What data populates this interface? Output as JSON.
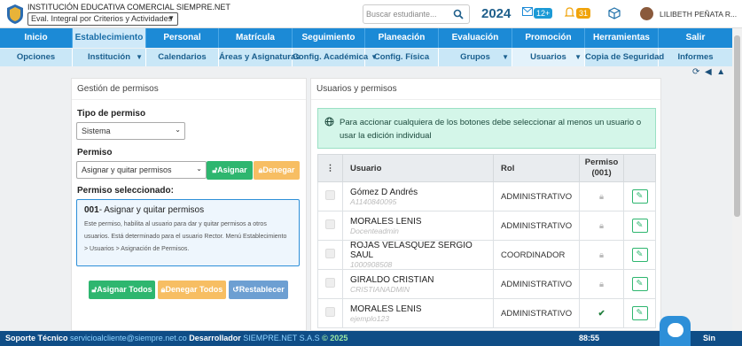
{
  "header": {
    "institution": "INSTITUCIÓN EDUCATIVA COMERCIAL SIEMPRE.NET",
    "evaluation_select": "Eval. Integral por Criterios y Actividades",
    "search_placeholder": "Buscar estudiante...",
    "year": "2024",
    "messages_badge": "12+",
    "notifications_badge": "31",
    "user_name": "LILIBETH PEÑATA R..."
  },
  "main_nav": [
    "Inicio",
    "Establecimiento",
    "Personal",
    "Matrícula",
    "Seguimiento",
    "Planeación",
    "Evaluación",
    "Promoción",
    "Herramientas",
    "Salir"
  ],
  "sub_nav": [
    {
      "label": "Opciones",
      "arrow": false
    },
    {
      "label": "Institución",
      "arrow": true
    },
    {
      "label": "Calendarios",
      "arrow": false
    },
    {
      "label": "Áreas y Asignaturas",
      "arrow": false
    },
    {
      "label": "Config. Académica",
      "arrow": true
    },
    {
      "label": "Config. Física",
      "arrow": false
    },
    {
      "label": "Grupos",
      "arrow": true
    },
    {
      "label": "Usuarios",
      "arrow": true
    },
    {
      "label": "Copia de Seguridad",
      "arrow": false
    },
    {
      "label": "Informes",
      "arrow": false
    }
  ],
  "left_panel": {
    "title": "Gestión de permisos",
    "tipo_label": "Tipo de permiso",
    "tipo_value": "Sistema",
    "permiso_label": "Permiso",
    "permiso_value": "Asignar y quitar permisos",
    "asignar_btn": "Asignar",
    "denegar_btn": "Denegar",
    "selected_label": "Permiso seleccionado:",
    "selected_code": "001",
    "selected_name": "- Asignar y quitar permisos",
    "selected_desc": "Este permiso, habilita al usuario para dar y quitar permisos a otros usuarios. Está determinado para el usuario Rector. Menú Establecimiento > Usuarios > Asignación de Permisos.",
    "asignar_todos_btn": "Asignar Todos",
    "denegar_todos_btn": "Denegar Todos",
    "restablecer_btn": "Restablecer"
  },
  "right_panel": {
    "title": "Usuarios y permisos",
    "alert": "Para accionar cualquiera de los botones debe seleccionar al menos un usuario o usar la edición individual",
    "columns": [
      "Usuario",
      "Rol",
      "Permiso (001)"
    ],
    "rows": [
      {
        "name": "Gómez D Andrés",
        "code": "A1140840095",
        "role": "ADMINISTRATIVO",
        "perm": "lock"
      },
      {
        "name": "MORALES LENIS",
        "code": "Docenteadmin",
        "role": "ADMINISTRATIVO",
        "perm": "lock"
      },
      {
        "name": "ROJAS VELASQUEZ SERGIO SAUL",
        "code": "1000908508",
        "role": "COORDINADOR",
        "perm": "lock"
      },
      {
        "name": "GIRALDO CRISTIAN",
        "code": "CRISTIANADMIN",
        "role": "ADMINISTRATIVO",
        "perm": "lock"
      },
      {
        "name": "MORALES LENIS",
        "code": "ejemplo123",
        "role": "ADMINISTRATIVO",
        "perm": "check"
      }
    ]
  },
  "footer": {
    "support_label": "Soporte Técnico",
    "support_email": "servicioalcliente@siempre.net.co",
    "dev_label": "Desarrollador",
    "dev_name": "SIEMPRE.NET S.A.S",
    "copyright": "© 2025",
    "time": "88:55",
    "brand": "Sin"
  },
  "colors": {
    "primary": "#1c8ad6",
    "subnav": "#c9e7f7",
    "green": "#2eb66f",
    "orange": "#f7be63",
    "footer": "#0f4d86"
  }
}
